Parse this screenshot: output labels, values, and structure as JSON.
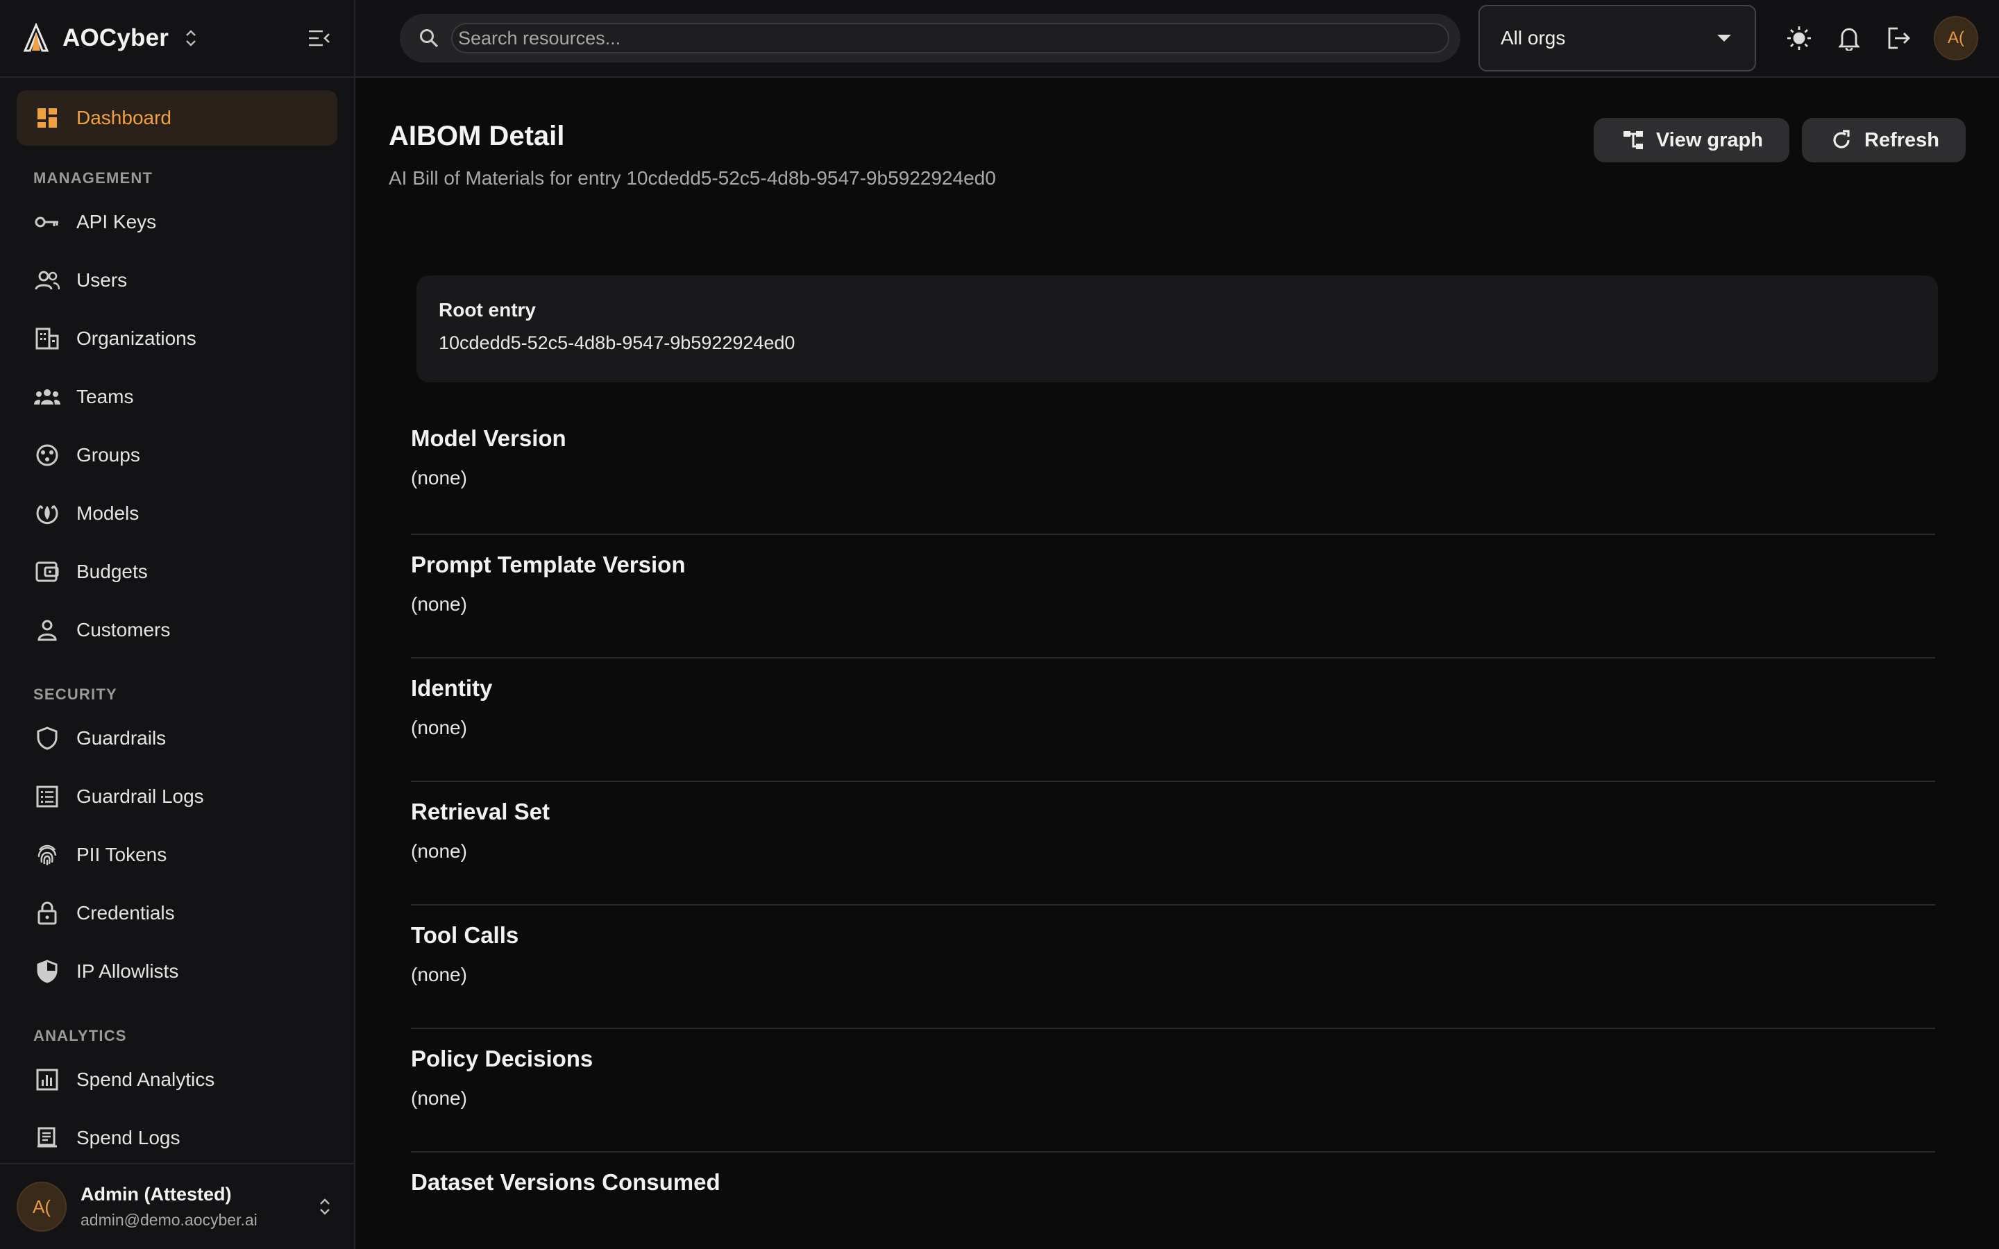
{
  "brand": {
    "name": "AOCyber"
  },
  "sidebar": {
    "primary": [
      {
        "label": "Dashboard",
        "icon": "dashboard-icon",
        "active": true
      }
    ],
    "sections": [
      {
        "label": "MANAGEMENT",
        "items": [
          {
            "label": "API Keys",
            "icon": "key-icon"
          },
          {
            "label": "Users",
            "icon": "users-icon"
          },
          {
            "label": "Organizations",
            "icon": "building-icon"
          },
          {
            "label": "Teams",
            "icon": "teams-icon"
          },
          {
            "label": "Groups",
            "icon": "groups-icon"
          },
          {
            "label": "Models",
            "icon": "models-icon"
          },
          {
            "label": "Budgets",
            "icon": "wallet-icon"
          },
          {
            "label": "Customers",
            "icon": "person-icon"
          }
        ]
      },
      {
        "label": "SECURITY",
        "items": [
          {
            "label": "Guardrails",
            "icon": "shield-icon"
          },
          {
            "label": "Guardrail Logs",
            "icon": "list-icon"
          },
          {
            "label": "PII Tokens",
            "icon": "fingerprint-icon"
          },
          {
            "label": "Credentials",
            "icon": "lock-icon"
          },
          {
            "label": "IP Allowlists",
            "icon": "shield-half-icon"
          }
        ]
      },
      {
        "label": "ANALYTICS",
        "items": [
          {
            "label": "Spend Analytics",
            "icon": "bar-chart-icon"
          },
          {
            "label": "Spend Logs",
            "icon": "receipt-icon"
          }
        ]
      }
    ],
    "user": {
      "initials": "A(",
      "name": "Admin (Attested)",
      "email": "admin@demo.aocyber.ai"
    }
  },
  "topbar": {
    "search_placeholder": "Search resources...",
    "org_select": "All orgs",
    "avatar_initials": "A("
  },
  "page": {
    "title": "AIBOM Detail",
    "subtitle": "AI Bill of Materials for entry 10cdedd5-52c5-4d8b-9547-9b5922924ed0",
    "actions": {
      "view_graph": "View graph",
      "refresh": "Refresh"
    },
    "root": {
      "label": "Root entry",
      "value": "10cdedd5-52c5-4d8b-9547-9b5922924ed0"
    },
    "sections": [
      {
        "title": "Model Version",
        "value": "(none)"
      },
      {
        "title": "Prompt Template Version",
        "value": "(none)"
      },
      {
        "title": "Identity",
        "value": "(none)"
      },
      {
        "title": "Retrieval Set",
        "value": "(none)"
      },
      {
        "title": "Tool Calls",
        "value": "(none)"
      },
      {
        "title": "Policy Decisions",
        "value": "(none)"
      },
      {
        "title": "Dataset Versions Consumed",
        "value": ""
      }
    ]
  },
  "colors": {
    "accent": "#f0a040",
    "background": "#0b0b0c",
    "sidebar": "#131315"
  }
}
